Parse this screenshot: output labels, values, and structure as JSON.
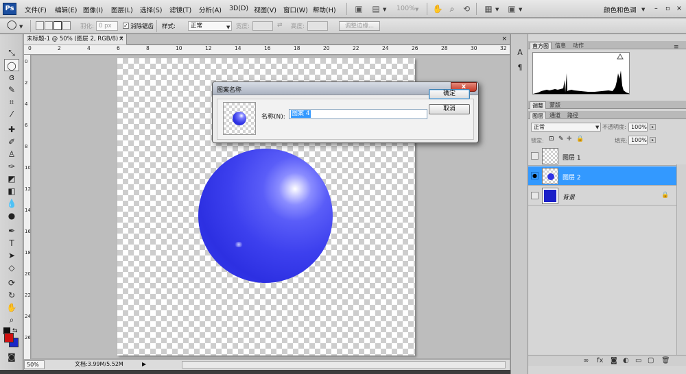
{
  "menubar": {
    "logo": "Ps",
    "items": [
      "文件(F)",
      "编辑(E)",
      "图像(I)",
      "图层(L)",
      "选择(S)",
      "滤镜(T)",
      "分析(A)",
      "3D(D)",
      "视图(V)",
      "窗口(W)",
      "帮助(H)"
    ],
    "zoom_value": "100%",
    "workspace": "颜色和色调",
    "window_controls": [
      "–",
      "▫",
      "×"
    ]
  },
  "options": {
    "feather_label": "羽化:",
    "feather_value": "0 px",
    "antialias_label": "消除锯齿",
    "style_label": "样式:",
    "style_value": "正常",
    "width_label": "宽度:",
    "height_label": "高度:",
    "refine_label": "调整边缘..."
  },
  "document": {
    "tab_title": "未标题-1 @ 50% (图层 2, RGB/8) *",
    "close": "×"
  },
  "rulers": {
    "h": [
      "0",
      "2",
      "4",
      "6",
      "8",
      "10",
      "12",
      "14",
      "16",
      "18",
      "20",
      "22",
      "24",
      "26",
      "28",
      "30",
      "32"
    ],
    "v": [
      "0",
      "2",
      "4",
      "6",
      "8",
      "10",
      "12",
      "14",
      "16",
      "18",
      "20",
      "22",
      "24",
      "26"
    ]
  },
  "status": {
    "zoom": "50%",
    "doc_info": "文档:3.99M/5.52M"
  },
  "dialog": {
    "title": "图案名称",
    "close": "x",
    "name_label": "名称(N):",
    "name_value": "图案 4",
    "ok": "确定",
    "cancel": "取消"
  },
  "panels": {
    "tabs_top": [
      "直方图",
      "信息",
      "动作"
    ],
    "tabs_mid": [
      "调整",
      "蒙版"
    ],
    "tabs_layers": [
      "图层",
      "通道",
      "路径"
    ],
    "blend_mode": "正常",
    "opacity_label": "不透明度:",
    "opacity_value": "100%",
    "lock_label": "锁定:",
    "fill_label": "填充:",
    "fill_value": "100%",
    "layers": [
      {
        "name": "图层 1"
      },
      {
        "name": "图层 2"
      },
      {
        "name": "背景"
      }
    ]
  }
}
